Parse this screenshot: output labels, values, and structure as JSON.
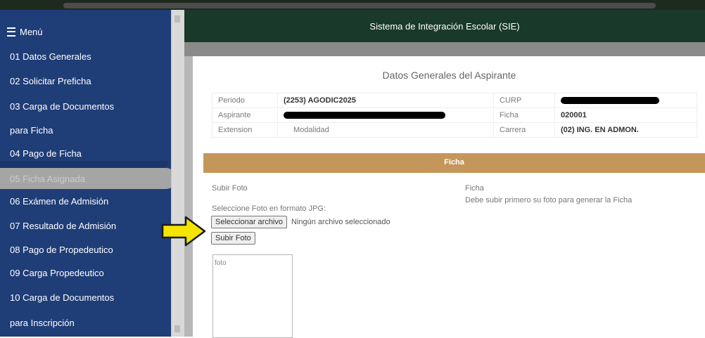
{
  "app": {
    "title": "Sistema de Integración Escolar (SIE)"
  },
  "sidebar": {
    "menu_label": "Menú",
    "items": [
      "01 Datos Generales",
      "02 Solicitar Preficha",
      "03 Carga de Documentos",
      "para Ficha",
      "04 Pago de Ficha",
      "05 Ficha Asignada",
      "06 Exámen de Admisión",
      "07 Resultado de Admisión",
      "08 Pago de Propedeutico",
      "09 Carga Propedeutico",
      "10 Carga de Documentos",
      "para Inscripción"
    ]
  },
  "main": {
    "section_title": "Datos Generales del Aspirante",
    "info": {
      "periodo_label": "Periodo",
      "periodo_value": "(2253) AGODIC2025",
      "curp_label": "CURP",
      "aspirante_label": "Aspirante",
      "ficha_label": "Ficha",
      "ficha_value": "020001",
      "extension_label": "Extension",
      "modalidad_label": "Modalidad",
      "carrera_label": "Carrera",
      "carrera_value": "(02) ING. EN ADMON."
    },
    "ficha_bar": "Ficha",
    "subir_foto_label": "Subir Foto",
    "seleccione_label": "Seleccione Foto en formato JPG:",
    "select_file_button": "Seleccionar archivo",
    "file_status": "Ningún archivo seleccionado",
    "upload_button": "Subir Foto",
    "ficha_label": "Ficha",
    "ficha_note": "Debe subir primero su foto para generar la Ficha",
    "photo_alt": "foto"
  },
  "colors": {
    "sidebar": "#1f3d77",
    "header": "#193a2a",
    "ficha_bar": "#c4965a",
    "arrow": "#f5e400"
  }
}
